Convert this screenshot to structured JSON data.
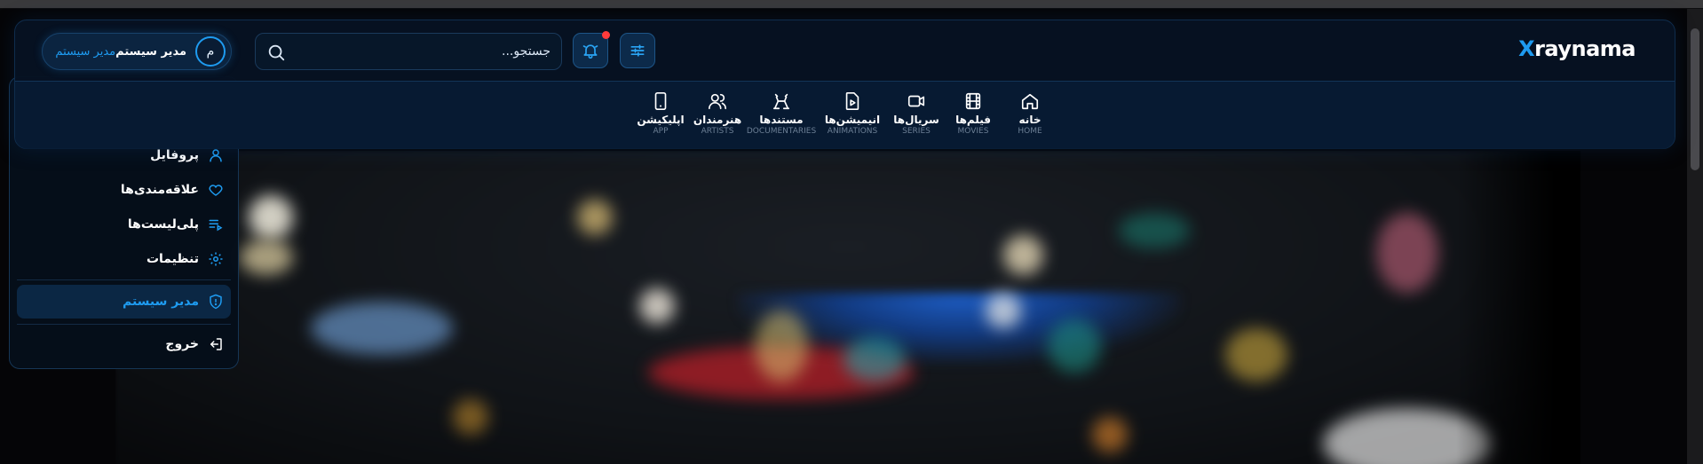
{
  "brand": {
    "logo_x": "X",
    "logo_rest": "raynama",
    "accent": "#1e9bf0"
  },
  "user": {
    "avatar_initial": "م",
    "name": "مدیر سیستم",
    "role": "مدیر سیستم"
  },
  "search": {
    "placeholder": "جستجو..."
  },
  "toolbar": {
    "bell_icon": "bell-icon",
    "filter_icon": "sliders-icon",
    "notification_dot_color": "#ff3b3b"
  },
  "nav": [
    {
      "fa": "خانه",
      "en": "HOME",
      "icon": "home-icon"
    },
    {
      "fa": "فیلم‌ها",
      "en": "MOVIES",
      "icon": "film-icon"
    },
    {
      "fa": "سریال‌ها",
      "en": "SERIES",
      "icon": "video-icon"
    },
    {
      "fa": "انیمیشن‌ها",
      "en": "ANIMATIONS",
      "icon": "file-play-icon"
    },
    {
      "fa": "مستندها",
      "en": "DOCUMENTARIES",
      "icon": "documentary-icon"
    },
    {
      "fa": "هنرمندان",
      "en": "ARTISTS",
      "icon": "users-icon"
    },
    {
      "fa": "اپلیکیشن",
      "en": "APP",
      "icon": "phone-icon"
    }
  ],
  "user_menu": {
    "profile": "پروفایل",
    "favorites": "علاقه‌مندی‌ها",
    "playlists": "پلی‌لیست‌ها",
    "settings": "تنظیمات",
    "admin": "مدیر سیستم",
    "logout": "خروج"
  }
}
